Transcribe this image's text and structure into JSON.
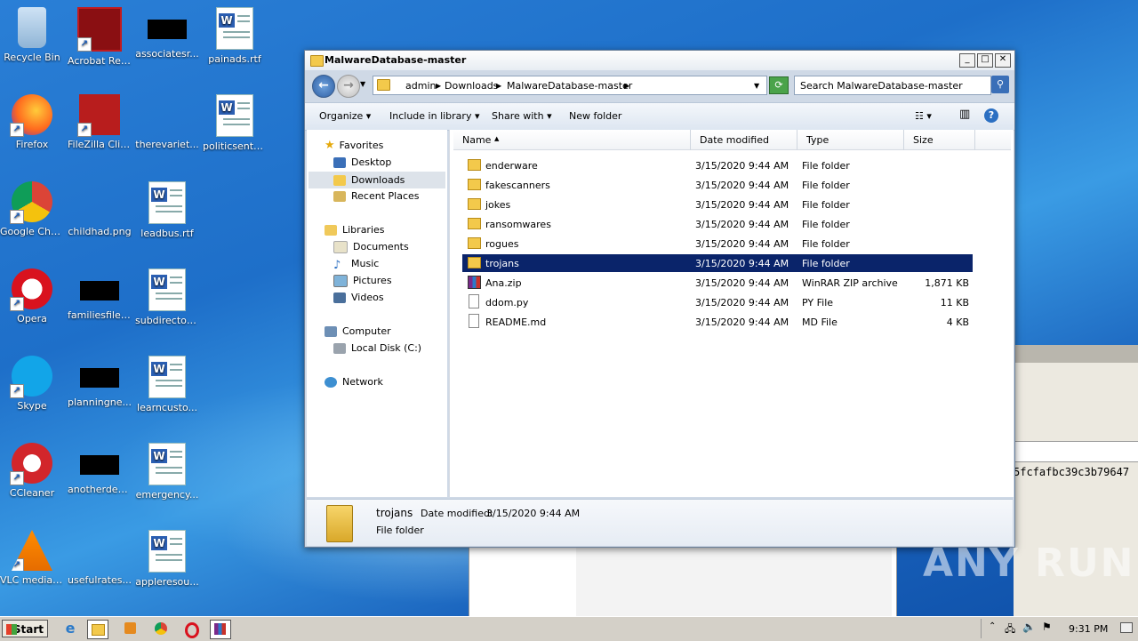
{
  "desktop": {
    "icons": [
      {
        "label": "Recycle Bin"
      },
      {
        "label": "Acrobat Reader DC"
      },
      {
        "label": "associatesr..."
      },
      {
        "label": "painads.rtf"
      },
      {
        "label": "Firefox"
      },
      {
        "label": "FileZilla Client"
      },
      {
        "label": "therevariet..."
      },
      {
        "label": "politicsenter..."
      },
      {
        "label": "Google Chrome"
      },
      {
        "label": "childhad.png"
      },
      {
        "label": "leadbus.rtf"
      },
      {
        "label": "Opera"
      },
      {
        "label": "familiesfiles..."
      },
      {
        "label": "subdirector.rtf"
      },
      {
        "label": "Skype"
      },
      {
        "label": "planningne..."
      },
      {
        "label": "learncusto..."
      },
      {
        "label": "CCleaner"
      },
      {
        "label": "anotherdec..."
      },
      {
        "label": "emergency..."
      },
      {
        "label": "VLC media player"
      },
      {
        "label": "usefulrates..."
      },
      {
        "label": "appleresou..."
      }
    ]
  },
  "background_window": {
    "hash_text": "5fcfafbc39c3b79647"
  },
  "explorer": {
    "title": "MalwareDatabase-master",
    "breadcrumb": [
      "admin",
      "Downloads",
      "MalwareDatabase-master"
    ],
    "search_placeholder": "Search MalwareDatabase-master",
    "toolbar": {
      "organize": "Organize",
      "include": "Include in library",
      "share": "Share with",
      "new_folder": "New folder"
    },
    "nav": {
      "favorites": "Favorites",
      "desktop": "Desktop",
      "downloads": "Downloads",
      "recent": "Recent Places",
      "libraries": "Libraries",
      "documents": "Documents",
      "music": "Music",
      "pictures": "Pictures",
      "videos": "Videos",
      "computer": "Computer",
      "local_disk": "Local Disk (C:)",
      "network": "Network"
    },
    "columns": {
      "name": "Name",
      "date": "Date modified",
      "type": "Type",
      "size": "Size"
    },
    "files": [
      {
        "name": "enderware",
        "date": "3/15/2020 9:44 AM",
        "type": "File folder",
        "size": ""
      },
      {
        "name": "fakescanners",
        "date": "3/15/2020 9:44 AM",
        "type": "File folder",
        "size": ""
      },
      {
        "name": "jokes",
        "date": "3/15/2020 9:44 AM",
        "type": "File folder",
        "size": ""
      },
      {
        "name": "ransomwares",
        "date": "3/15/2020 9:44 AM",
        "type": "File folder",
        "size": ""
      },
      {
        "name": "rogues",
        "date": "3/15/2020 9:44 AM",
        "type": "File folder",
        "size": ""
      },
      {
        "name": "trojans",
        "date": "3/15/2020 9:44 AM",
        "type": "File folder",
        "size": ""
      },
      {
        "name": "Ana.zip",
        "date": "3/15/2020 9:44 AM",
        "type": "WinRAR ZIP archive",
        "size": "1,871 KB"
      },
      {
        "name": "ddom.py",
        "date": "3/15/2020 9:44 AM",
        "type": "PY File",
        "size": "11 KB"
      },
      {
        "name": "README.md",
        "date": "3/15/2020 9:44 AM",
        "type": "MD File",
        "size": "4 KB"
      }
    ],
    "details": {
      "name": "trojans",
      "date_label": "Date modified:",
      "date": "3/15/2020 9:44 AM",
      "type": "File folder"
    }
  },
  "taskbar": {
    "start": "Start",
    "clock": "9:31 PM"
  },
  "watermark": "ANY RUN"
}
